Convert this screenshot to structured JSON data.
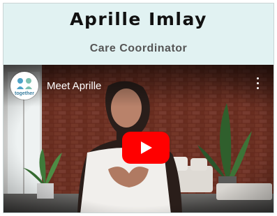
{
  "profile": {
    "name": "Aprille Imlay",
    "role": "Care Coordinator"
  },
  "video": {
    "title": "Meet Aprille",
    "channel_logo_text": "together",
    "play_color": "#ff0000"
  },
  "colors": {
    "header_bg": "#e1f2f2",
    "brick": "#8a3b2a"
  }
}
